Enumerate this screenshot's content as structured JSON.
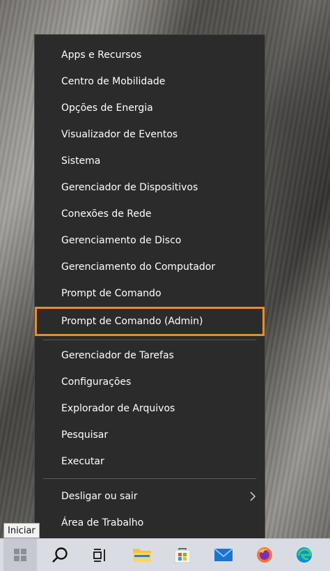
{
  "menu": {
    "items": [
      {
        "label": "Apps e Recursos"
      },
      {
        "label": "Centro de Mobilidade"
      },
      {
        "label": "Opções de Energia"
      },
      {
        "label": "Visualizador de Eventos"
      },
      {
        "label": "Sistema"
      },
      {
        "label": "Gerenciador de Dispositivos"
      },
      {
        "label": "Conexões de Rede"
      },
      {
        "label": "Gerenciamento de Disco"
      },
      {
        "label": "Gerenciamento do Computador"
      },
      {
        "label": "Prompt de Comando"
      },
      {
        "label": "Prompt de Comando (Admin)",
        "highlighted": true
      },
      {
        "label": "Gerenciador de Tarefas"
      },
      {
        "label": "Configurações"
      },
      {
        "label": "Explorador de Arquivos"
      },
      {
        "label": "Pesquisar"
      },
      {
        "label": "Executar"
      },
      {
        "label": "Desligar ou sair",
        "submenu": true
      },
      {
        "label": "Área de Trabalho"
      }
    ],
    "highlight_color": "#F08A24"
  },
  "tooltip": {
    "label": "Iniciar"
  },
  "taskbar": {
    "icons": [
      "windows-start-icon",
      "search-icon",
      "task-view-icon",
      "file-explorer-icon",
      "microsoft-store-icon",
      "mail-icon",
      "firefox-icon",
      "edge-icon"
    ]
  }
}
